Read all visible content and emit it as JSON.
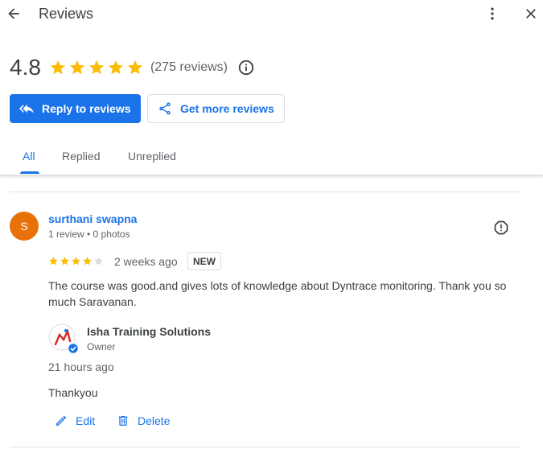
{
  "header": {
    "title": "Reviews"
  },
  "summary": {
    "rating": "4.8",
    "stars": 5,
    "review_count": "(275 reviews)"
  },
  "actions": {
    "reply_label": "Reply to reviews",
    "get_more_label": "Get more reviews"
  },
  "tabs": [
    {
      "label": "All",
      "active": true
    },
    {
      "label": "Replied",
      "active": false
    },
    {
      "label": "Unreplied",
      "active": false
    }
  ],
  "review": {
    "avatar_letter": "S",
    "author": "surthani swapna",
    "meta": "1 review • 0 photos",
    "rating": 4,
    "time": "2 weeks ago",
    "badge": "NEW",
    "text": "The course was good.and gives lots of knowledge about Dyntrace monitoring. Thank you so much Saravanan.",
    "reply": {
      "owner_name": "Isha Training Solutions",
      "owner_role": "Owner",
      "time": "21 hours ago",
      "text": "Thankyou",
      "edit_label": "Edit",
      "delete_label": "Delete"
    }
  },
  "colors": {
    "accent": "#1a73e8",
    "star": "#fbbc04",
    "avatar": "#e8710a"
  }
}
